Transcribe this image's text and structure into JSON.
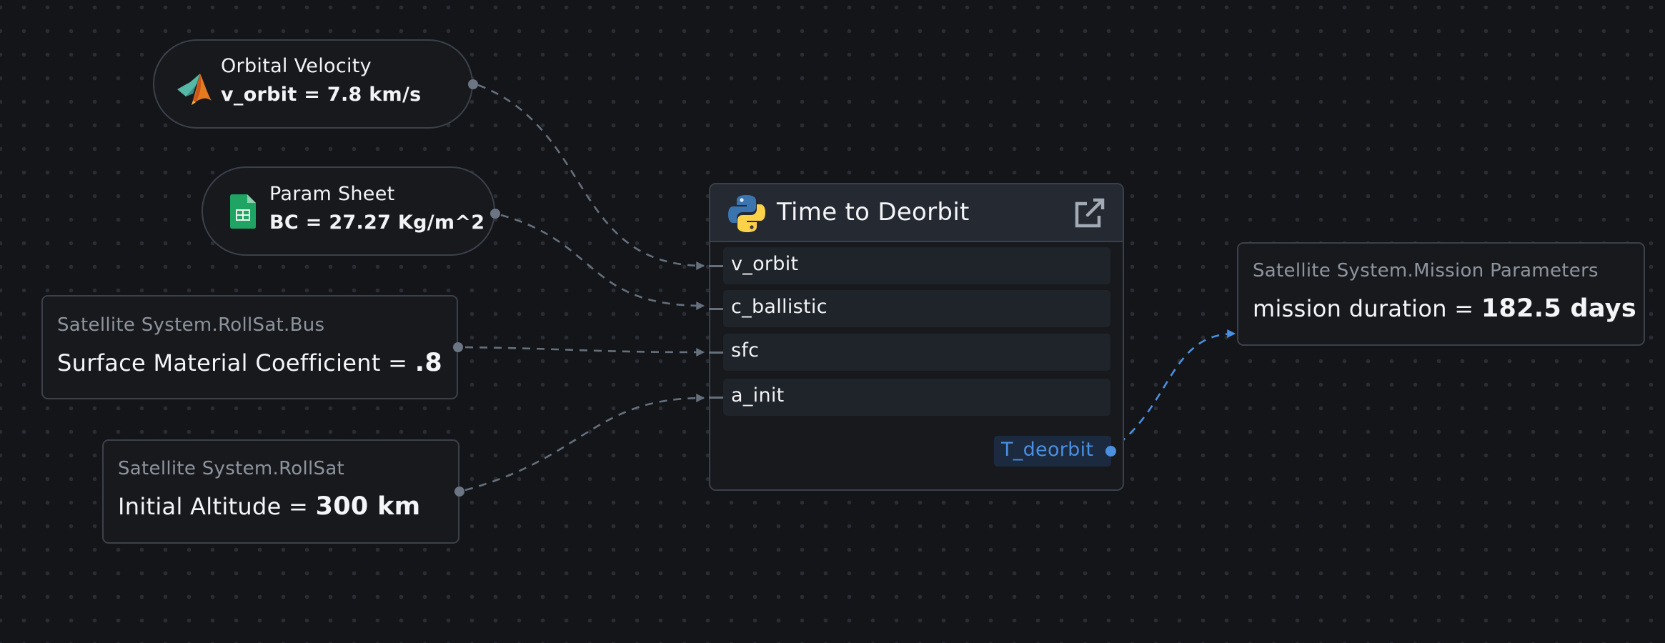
{
  "canvas": {
    "background": "#131519",
    "edge_color": "#66707d",
    "output_edge_color": "#4a8fe0"
  },
  "sources": [
    {
      "id": "orbital-velocity",
      "kind": "matlab",
      "icon": "matlab-icon",
      "title": "Orbital Velocity",
      "value_text": "v_orbit = 7.8 km/s",
      "connects_to": "v_orbit"
    },
    {
      "id": "param-sheet",
      "kind": "sheets",
      "icon": "google-sheets-icon",
      "title": "Param Sheet",
      "value_text": "BC = 27.27 Kg/m^2",
      "connects_to": "c_ballistic"
    }
  ],
  "requirements": [
    {
      "id": "surface-coefficient",
      "path": "Satellite System.RollSat.Bus",
      "label": "Surface Material Coefficient = ",
      "value": ".8",
      "connects_to": "sfc"
    },
    {
      "id": "initial-altitude",
      "path": "Satellite System.RollSat",
      "label": "Initial Altitude = ",
      "value": "300 km",
      "connects_to": "a_init"
    }
  ],
  "function_node": {
    "icon": "python-icon",
    "title": "Time to Deorbit",
    "open_icon": "external-link-icon",
    "inputs": [
      "v_orbit",
      "c_ballistic",
      "sfc",
      "a_init"
    ],
    "output": "T_deorbit",
    "output_color": "#4a8fe0"
  },
  "result": {
    "path": "Satellite System.Mission Parameters",
    "label": "mission duration = ",
    "value": "182.5 days"
  }
}
